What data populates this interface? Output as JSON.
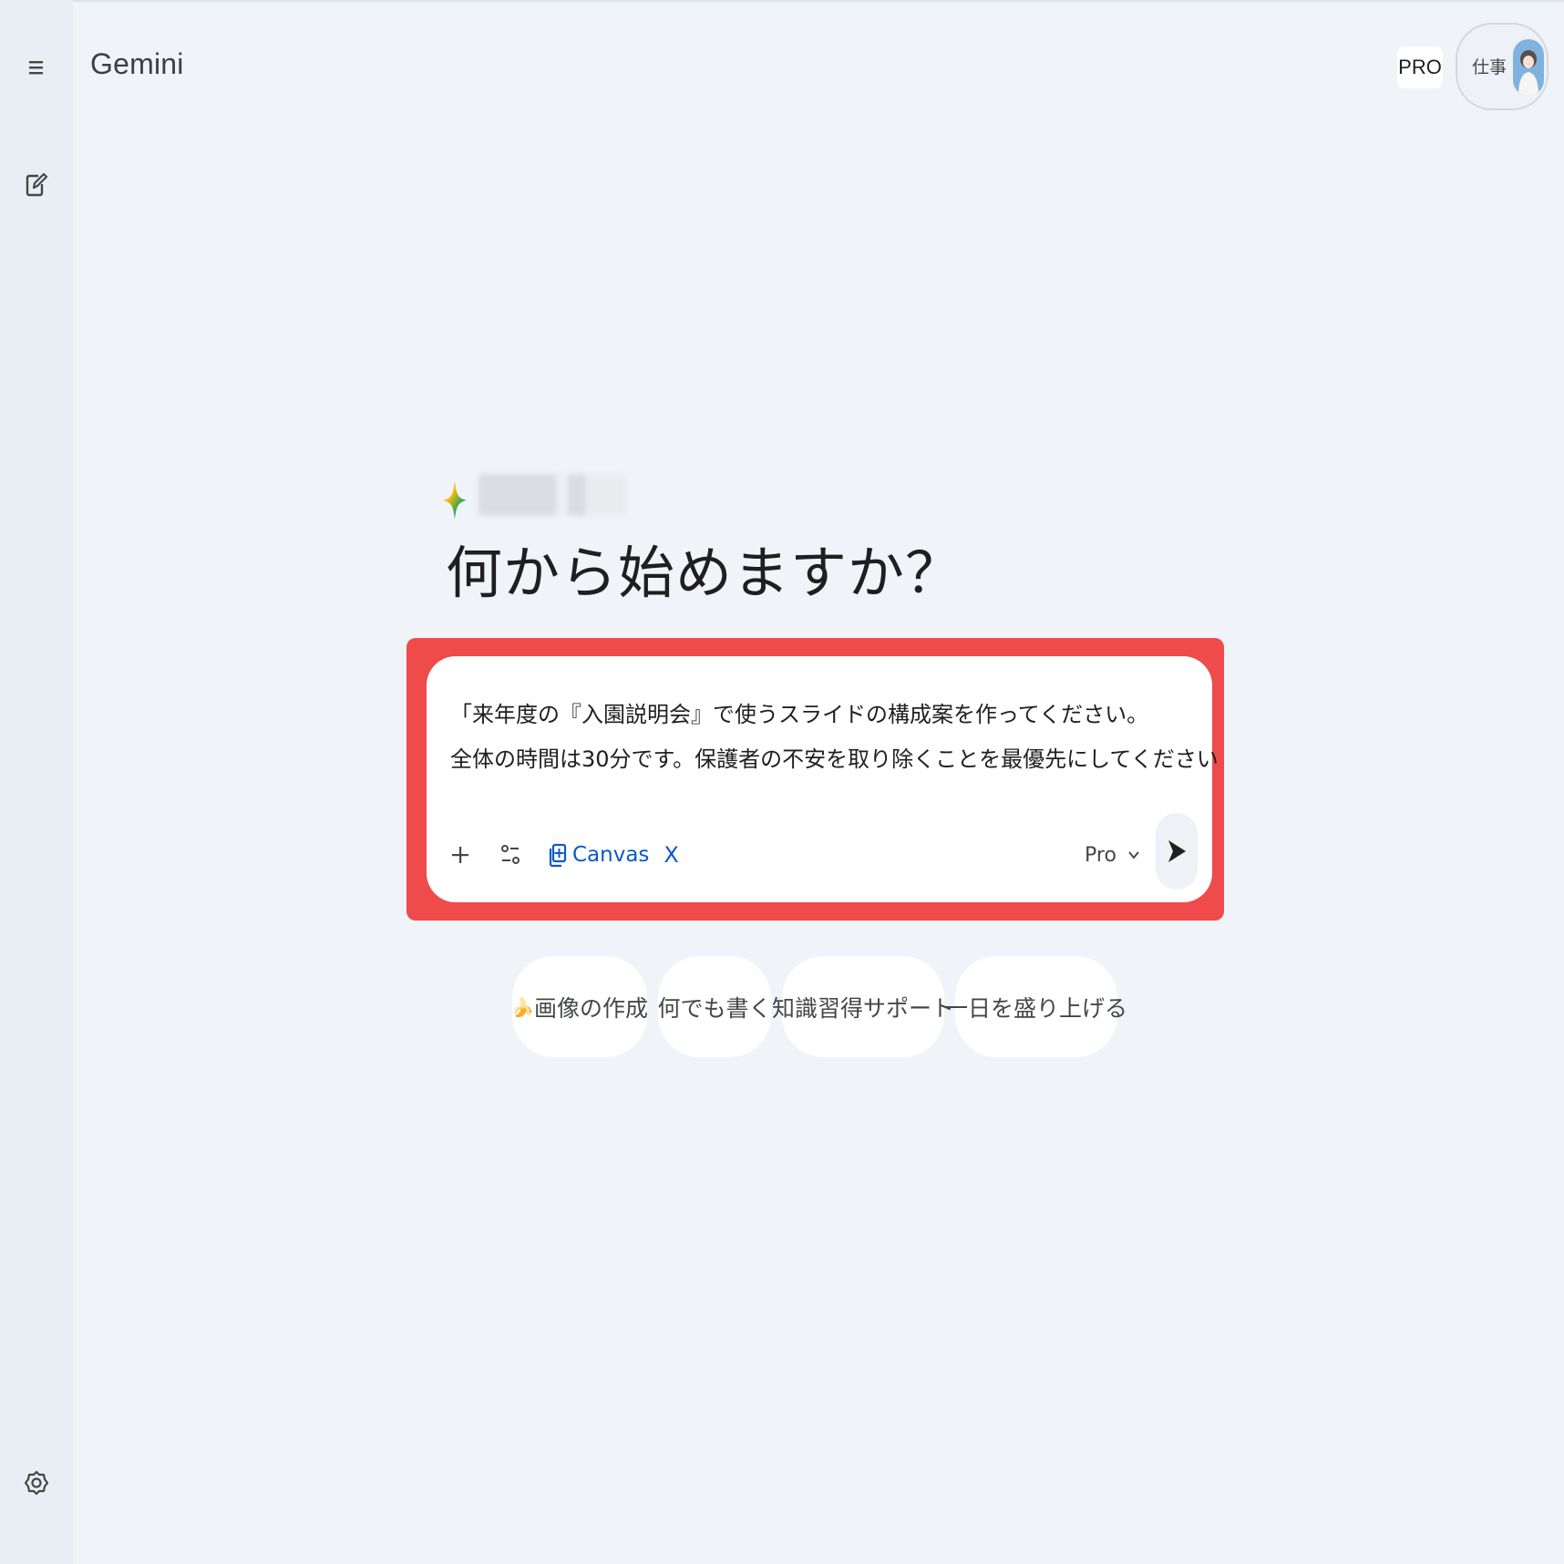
{
  "header": {
    "app_title": "Gemini",
    "plan_badge": "PRO",
    "account_label": "仕事"
  },
  "sidebar": {
    "menu_icon": "menu-icon",
    "new_chat_icon": "edit-icon",
    "settings_icon": "gear-icon"
  },
  "greeting": {
    "title": "何から始めますか？"
  },
  "prompt": {
    "lines": [
      "「来年度の『入園説明会』で使うスライドの構成案を作ってください。",
      "全体の時間は30分です。保護者の不安を取り除くことを最優先にしてください"
    ],
    "tool_label": "Canvas",
    "tool_close": "X",
    "model": "Pro",
    "accent": "#0b57d0",
    "highlight_color": "#ef4b4b"
  },
  "suggestions": [
    {
      "emoji": "🍌",
      "label": "画像の作成"
    },
    {
      "label": "何でも書く"
    },
    {
      "label": "知識習得サポート"
    },
    {
      "label": "一日を盛り上げる"
    }
  ]
}
